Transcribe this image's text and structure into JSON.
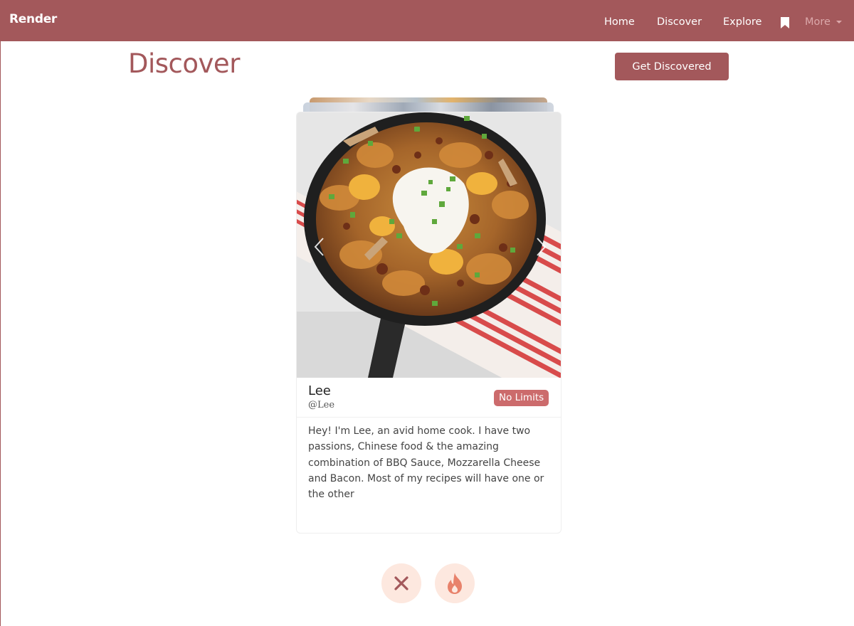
{
  "navbar": {
    "brand": "Render",
    "links": {
      "home": "Home",
      "discover": "Discover",
      "explore": "Explore",
      "more": "More"
    }
  },
  "header": {
    "title": "Discover",
    "cta": "Get Discovered"
  },
  "card": {
    "name": "Lee",
    "handle": "@Lee",
    "badge": "No Limits",
    "bio": "Hey! I'm Lee, an avid home cook. I have two passions, Chinese food & the amazing combination of BBQ Sauce, Mozzarella Cheese and Bacon. Most of my recipes will have one or the other"
  },
  "actions": {
    "reject_icon": "close-icon",
    "like_icon": "flame-icon"
  },
  "colors": {
    "brand": "#a3585b",
    "badge": "#cc6b6c",
    "action_bg": "#fde8df",
    "like": "#e8826b"
  }
}
